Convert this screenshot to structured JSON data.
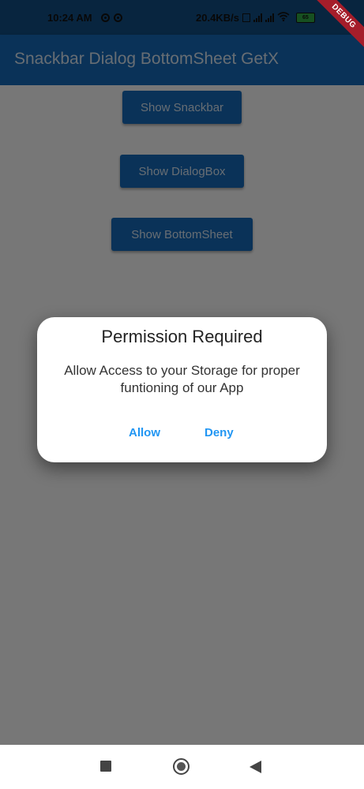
{
  "status_bar": {
    "time": "10:24 AM",
    "network_speed": "20.4KB/s",
    "battery_level": "65",
    "icons": [
      "sync-icon",
      "sync-icon",
      "data-saver-icon",
      "signal-icon",
      "signal-icon",
      "wifi-icon",
      "battery-icon"
    ]
  },
  "debug_banner": "DEBUG",
  "app_bar": {
    "title": "Snackbar Dialog BottomSheet GetX"
  },
  "buttons": {
    "snackbar": "Show Snackbar",
    "dialog": "Show DialogBox",
    "bottomsheet": "Show BottomSheet"
  },
  "dialog": {
    "title": "Permission Required",
    "message": "Allow Access to your Storage for proper funtioning of our App",
    "actions": {
      "allow": "Allow",
      "deny": "Deny"
    }
  },
  "nav_bar": {
    "icons": [
      "recent-apps-icon",
      "home-icon",
      "back-icon"
    ]
  },
  "colors": {
    "primary": "#1565b0",
    "status_bar": "#104a7e",
    "dialog_action": "#2196f3",
    "debug_ribbon": "#a51d2a",
    "overlay": "rgba(0,0,0,0.5)"
  }
}
